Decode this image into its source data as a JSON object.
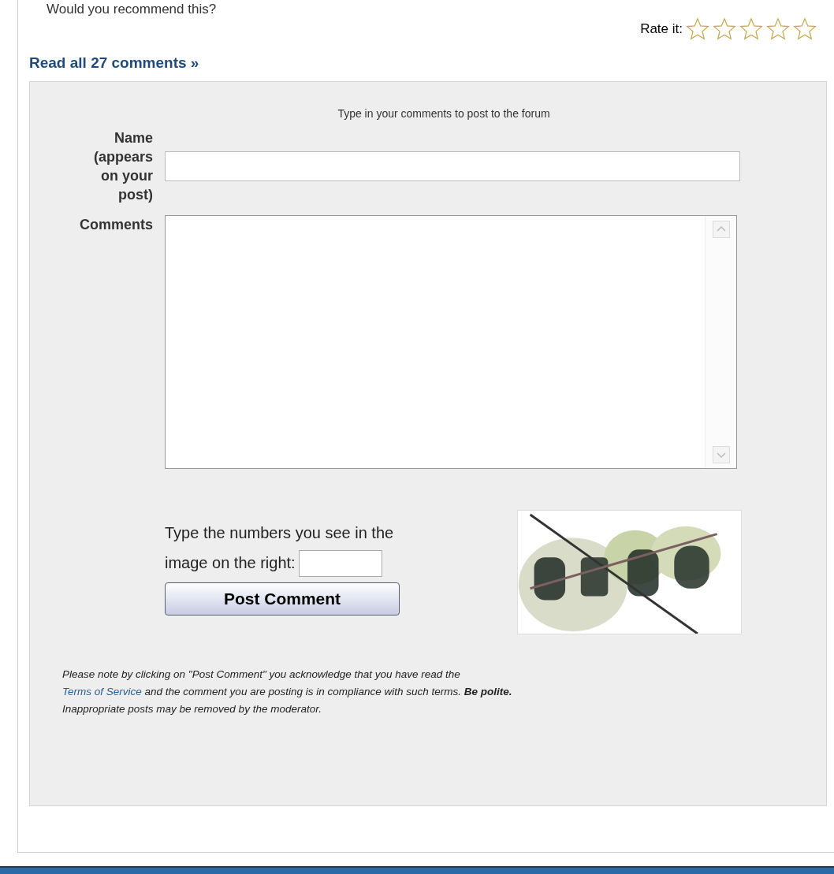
{
  "question": "Would you recommend this?",
  "rating": {
    "label": "Rate it:",
    "stars": 0
  },
  "comments_link": "Read all 27 comments »",
  "form": {
    "intro": "Type in your comments to post to the forum",
    "name_label": "Name (appears on your post)",
    "comments_label": "Comments",
    "captcha_prompt": "Type the numbers you see in the image on the right:",
    "submit": "Post Comment",
    "note_start": "Please note by clicking on \"Post Comment\" you acknowledge that you have read the",
    "terms_link": "Terms of Service",
    "note_middle": "and the comment you are posting is in compliance with such terms.",
    "note_bold": "Be polite.",
    "note_end": "Inappropriate posts may be removed by the moderator."
  }
}
